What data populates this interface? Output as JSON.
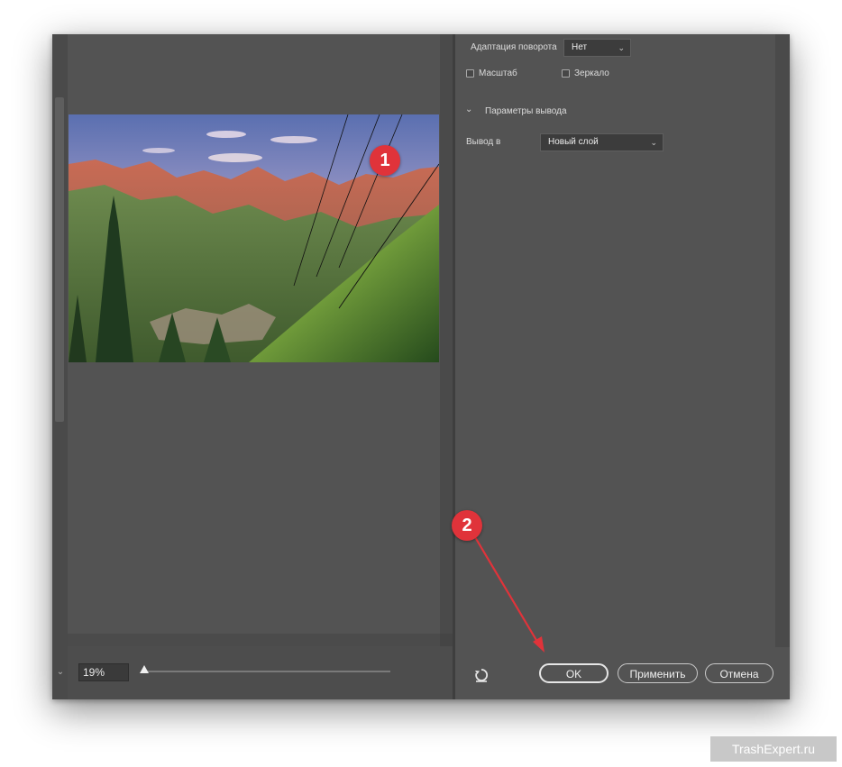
{
  "settings": {
    "rotation_label": "Адаптация поворота",
    "rotation_value": "Нет",
    "scale_label": "Масштаб",
    "mirror_label": "Зеркало",
    "output_section_title": "Параметры вывода",
    "output_label": "Вывод в",
    "output_value": "Новый слой"
  },
  "zoom": {
    "value": "19%",
    "slider_fraction": 0.0
  },
  "buttons": {
    "ok": "OK",
    "apply": "Применить",
    "cancel": "Отмена"
  },
  "annotations": {
    "marker1": "1",
    "marker2": "2",
    "color": "#e0333a"
  },
  "watermark": "TrashExpert.ru",
  "icons": [
    "reset-icon",
    "chevron-down-icon",
    "scroll-down-icon"
  ]
}
